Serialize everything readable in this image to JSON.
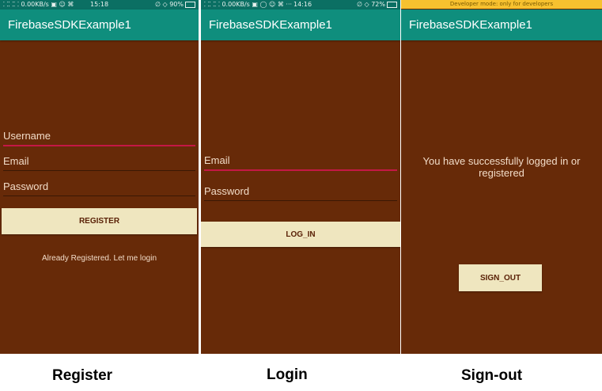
{
  "screens": [
    {
      "status_left": "⸬⸬⸬ 0.00KB/s ▣ ☺ ⌘",
      "status_time": "15:18",
      "status_right": "∅ ◇ 90%",
      "app_title": "FirebaseSDKExample1",
      "username_hint": "Username",
      "email_hint": "Email",
      "password_hint": "Password",
      "register_label": "REGISTER",
      "login_link": "Already Registered. Let me login",
      "caption": "Register"
    },
    {
      "status_left": "⸬⸬⸬ 0.00KB/s ▣ ◯ ☺ ⌘ ···",
      "status_time": "14:16",
      "status_right": "∅ ◇ 72%",
      "app_title": "FirebaseSDKExample1",
      "email_hint": "Email",
      "password_hint": "Password",
      "login_label": "LOG_IN",
      "caption": "Login"
    },
    {
      "dev_banner": "Developer mode: only for developers",
      "app_title": "FirebaseSDKExample1",
      "message": "You have successfully logged in or registered",
      "signout_label": "SIGN_OUT",
      "caption": "Sign-out"
    }
  ],
  "colors": {
    "background": "#672a08",
    "appbar": "#0f8e7d",
    "statusbar": "#0b6f63",
    "button": "#efe6bf",
    "accent": "#c41845"
  }
}
